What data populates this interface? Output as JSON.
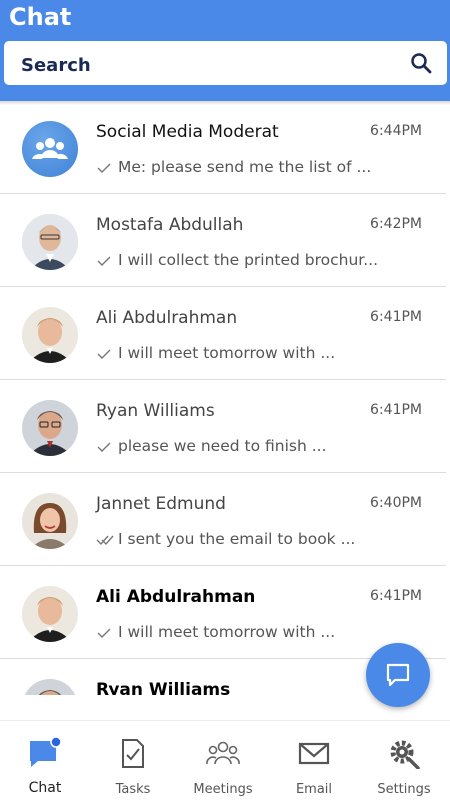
{
  "app": {
    "title": "Chat"
  },
  "search": {
    "placeholder": "Search",
    "icon": "search-icon"
  },
  "colors": {
    "accent": "#4a89e8",
    "badge": "#2a66d9"
  },
  "chats": [
    {
      "name": "Social Media Moderat",
      "time": "6:44PM",
      "message": "Me: please send me the list of ...",
      "status": "sent"
    },
    {
      "name": "Mostafa Abdullah",
      "time": "6:42PM",
      "message": "I will collect the printed brochur...",
      "status": "sent"
    },
    {
      "name": "Ali Abdulrahman",
      "time": "6:41PM",
      "message": "I will meet tomorrow with ...",
      "status": "sent"
    },
    {
      "name": "Ryan Williams",
      "time": "6:41PM",
      "message": "please we need to finish ...",
      "status": "sent"
    },
    {
      "name": "Jannet Edmund",
      "time": "6:40PM",
      "message": "I sent you the email to book ...",
      "status": "delivered"
    },
    {
      "name": "Ali Abdulrahman",
      "time": "6:41PM",
      "message": "I will meet tomorrow with ...",
      "status": "sent"
    },
    {
      "name": "Ryan Williams",
      "time": "",
      "message": "",
      "status": ""
    }
  ],
  "tabs": [
    {
      "label": "Chat",
      "icon": "chat-icon",
      "active": true
    },
    {
      "label": "Tasks",
      "icon": "tasks-icon",
      "active": false
    },
    {
      "label": "Meetings",
      "icon": "meetings-icon",
      "active": false
    },
    {
      "label": "Email",
      "icon": "email-icon",
      "active": false
    },
    {
      "label": "Settings",
      "icon": "settings-icon",
      "active": false
    }
  ]
}
